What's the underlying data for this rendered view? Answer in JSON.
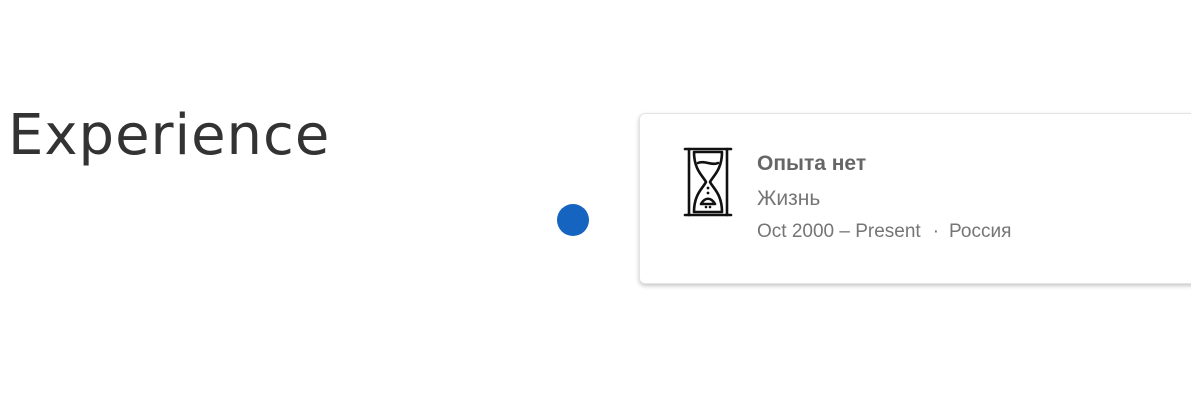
{
  "section": {
    "title": "Experience"
  },
  "timeline": {
    "dot_color": "#1565c0"
  },
  "experience": {
    "icon": "hourglass-icon",
    "title": "Опыта нет",
    "organization": "Жизнь",
    "period": "Oct 2000 – Present",
    "separator": "·",
    "location": "Россия"
  }
}
